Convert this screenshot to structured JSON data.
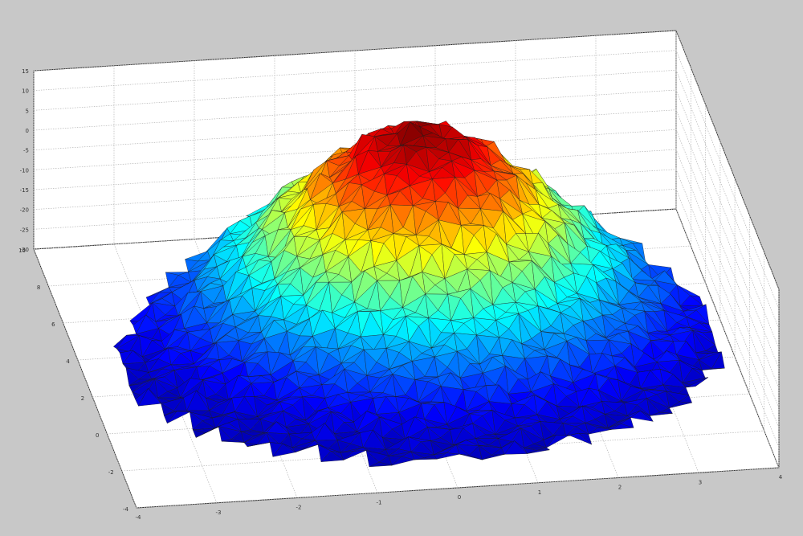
{
  "chart_data": {
    "type": "surface",
    "title": "",
    "xlabel": "",
    "ylabel": "",
    "zlabel": "",
    "xlim": [
      -4,
      4
    ],
    "ylim": [
      -4,
      10
    ],
    "zlim": [
      -30,
      15
    ],
    "x_ticks": [
      "-4",
      "-3",
      "-2",
      "-1",
      "0",
      "1",
      "2",
      "3",
      "4"
    ],
    "y_ticks": [
      "-4",
      "-2",
      "0",
      "2",
      "4",
      "6",
      "8",
      "10"
    ],
    "z_ticks": [
      "-30",
      "-25",
      "-20",
      "-15",
      "-10",
      "-5",
      "0",
      "5",
      "10",
      "15"
    ],
    "grid": true,
    "colormap": "jet",
    "colors": {
      "background": "#c8c8c8",
      "panel": "#ffffff",
      "grid": "#b5b5b5"
    },
    "surface": {
      "description_of_shape": "",
      "x_range": [
        -3.5,
        3.8
      ],
      "y_range": [
        -2.6,
        8.4
      ],
      "peak_z": 14,
      "peak_x": 0.4,
      "peak_y": 5.6,
      "base_z": -30,
      "spread_x": 2.2,
      "spread_y": 4.0,
      "resolution": 26
    }
  }
}
